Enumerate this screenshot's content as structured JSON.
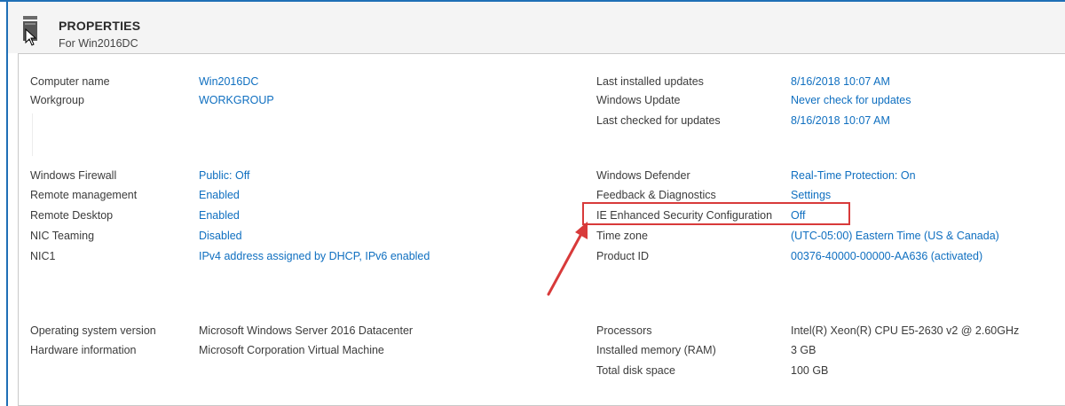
{
  "header": {
    "title": "PROPERTIES",
    "subtitle": "For Win2016DC"
  },
  "left_col": [
    {
      "label": "Computer name",
      "value": "Win2016DC",
      "link": true
    },
    {
      "label": "Workgroup",
      "value": "WORKGROUP",
      "link": true
    },
    {
      "label": "Windows Firewall",
      "value": "Public: Off",
      "link": true
    },
    {
      "label": "Remote management",
      "value": "Enabled",
      "link": true
    },
    {
      "label": "Remote Desktop",
      "value": "Enabled",
      "link": true
    },
    {
      "label": "NIC Teaming",
      "value": "Disabled",
      "link": true
    },
    {
      "label": "NIC1",
      "value": "IPv4 address assigned by DHCP, IPv6 enabled",
      "link": true
    },
    {
      "label": "Operating system version",
      "value": "Microsoft Windows Server 2016 Datacenter",
      "link": false
    },
    {
      "label": "Hardware information",
      "value": "Microsoft Corporation Virtual Machine",
      "link": false
    }
  ],
  "right_col": [
    {
      "label": "Last installed updates",
      "value": "8/16/2018 10:07 AM",
      "link": true
    },
    {
      "label": "Windows Update",
      "value": "Never check for updates",
      "link": true
    },
    {
      "label": "Last checked for updates",
      "value": "8/16/2018 10:07 AM",
      "link": true
    },
    {
      "label": "Windows Defender",
      "value": "Real-Time Protection: On",
      "link": true
    },
    {
      "label": "Feedback & Diagnostics",
      "value": "Settings",
      "link": true
    },
    {
      "label": "IE Enhanced Security Configuration",
      "value": "Off",
      "link": true
    },
    {
      "label": "Time zone",
      "value": "(UTC-05:00) Eastern Time (US & Canada)",
      "link": true
    },
    {
      "label": "Product ID",
      "value": "00376-40000-00000-AA636 (activated)",
      "link": true
    },
    {
      "label": "Processors",
      "value": "Intel(R) Xeon(R) CPU E5-2630 v2 @ 2.60GHz",
      "link": false
    },
    {
      "label": "Installed memory (RAM)",
      "value": "3 GB",
      "link": false
    },
    {
      "label": "Total disk space",
      "value": "100 GB",
      "link": false
    }
  ],
  "colors": {
    "link": "#0f6fc0",
    "text": "#3b3b3b",
    "highlight": "#d83a3a",
    "frame": "#1f6fb6"
  },
  "icons": {
    "header_icon": "server-icon",
    "cursor": "mouse-pointer-icon"
  },
  "highlight_target": "IE Enhanced Security Configuration"
}
